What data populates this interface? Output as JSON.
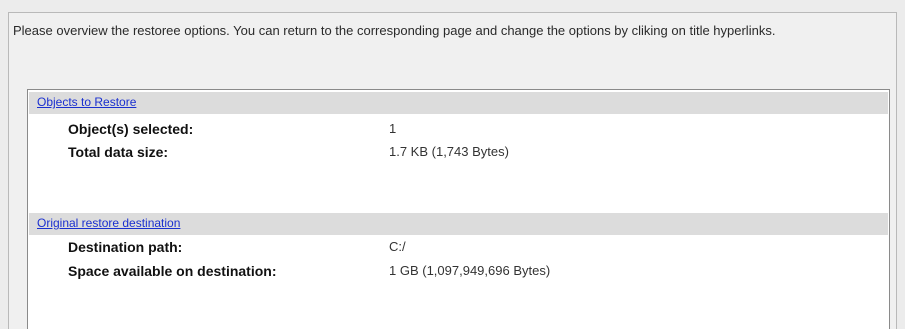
{
  "intro_text": "Please overview the restoree options. You can return to the corresponding page and change the options by cliking on title hyperlinks.",
  "sections": [
    {
      "title": "Objects to Restore",
      "rows": [
        {
          "label": "Object(s) selected:",
          "value": "1"
        },
        {
          "label": "Total data size:",
          "value": "1.7 KB (1,743 Bytes)"
        }
      ]
    },
    {
      "title": "Original restore destination",
      "rows": [
        {
          "label": "Destination path:",
          "value": "C:/"
        },
        {
          "label": "Space available on destination:",
          "value": "1 GB (1,097,949,696 Bytes)"
        }
      ]
    }
  ],
  "colors": {
    "link": "#1a2fd0",
    "section_header_bg": "#dcdcdc",
    "panel_bg": "#ffffff",
    "window_bg": "#f0f0f0"
  }
}
